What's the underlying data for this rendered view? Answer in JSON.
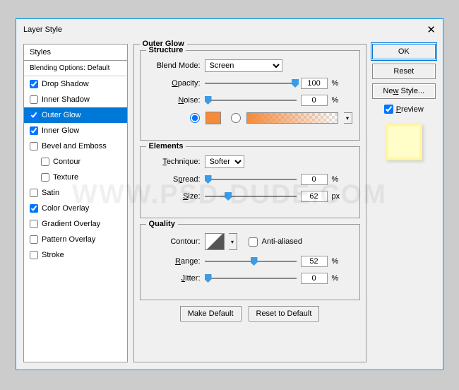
{
  "dialog": {
    "title": "Layer Style"
  },
  "styles": {
    "header": "Styles",
    "subheader": "Blending Options: Default",
    "items": [
      {
        "label": "Drop Shadow",
        "checked": true,
        "selected": false,
        "indent": false
      },
      {
        "label": "Inner Shadow",
        "checked": false,
        "selected": false,
        "indent": false
      },
      {
        "label": "Outer Glow",
        "checked": true,
        "selected": true,
        "indent": false
      },
      {
        "label": "Inner Glow",
        "checked": true,
        "selected": false,
        "indent": false
      },
      {
        "label": "Bevel and Emboss",
        "checked": false,
        "selected": false,
        "indent": false
      },
      {
        "label": "Contour",
        "checked": false,
        "selected": false,
        "indent": true
      },
      {
        "label": "Texture",
        "checked": false,
        "selected": false,
        "indent": true
      },
      {
        "label": "Satin",
        "checked": false,
        "selected": false,
        "indent": false
      },
      {
        "label": "Color Overlay",
        "checked": true,
        "selected": false,
        "indent": false
      },
      {
        "label": "Gradient Overlay",
        "checked": false,
        "selected": false,
        "indent": false
      },
      {
        "label": "Pattern Overlay",
        "checked": false,
        "selected": false,
        "indent": false
      },
      {
        "label": "Stroke",
        "checked": false,
        "selected": false,
        "indent": false
      }
    ]
  },
  "section": {
    "title": "Outer Glow",
    "structure": {
      "legend": "Structure",
      "blend_mode_label": "Blend Mode:",
      "blend_mode_value": "Screen",
      "opacity_label": "Opacity:",
      "opacity_value": "100",
      "opacity_unit": "%",
      "noise_label": "Noise:",
      "noise_value": "0",
      "noise_unit": "%",
      "color": "#f58a3c"
    },
    "elements": {
      "legend": "Elements",
      "technique_label": "Technique:",
      "technique_value": "Softer",
      "spread_label": "Spread:",
      "spread_value": "0",
      "spread_unit": "%",
      "size_label": "Size:",
      "size_value": "62",
      "size_unit": "px"
    },
    "quality": {
      "legend": "Quality",
      "contour_label": "Contour:",
      "antialiased_label": "Anti-aliased",
      "range_label": "Range:",
      "range_value": "52",
      "range_unit": "%",
      "jitter_label": "Jitter:",
      "jitter_value": "0",
      "jitter_unit": "%"
    },
    "buttons": {
      "make_default": "Make Default",
      "reset_default": "Reset to Default"
    }
  },
  "right": {
    "ok": "OK",
    "reset": "Reset",
    "new_style": "New Style...",
    "preview": "Preview"
  },
  "watermark": "WWW.PSD-DUDE.COM"
}
